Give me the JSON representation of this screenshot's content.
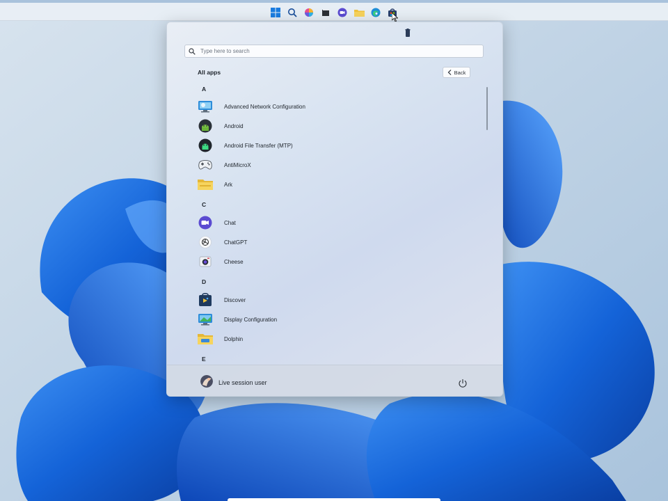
{
  "taskbar": {
    "icons": [
      "windows-start-icon",
      "search-icon",
      "copilot-icon",
      "task-view-icon",
      "chat-icon",
      "file-explorer-icon",
      "edge-icon",
      "store-icon"
    ]
  },
  "start_menu": {
    "search": {
      "placeholder": "Type here to search",
      "value": ""
    },
    "title": "All apps",
    "back_label": "Back",
    "sections": [
      {
        "letter": "A",
        "apps": [
          {
            "label": "Advanced Network Configuration",
            "icon": "network-config-icon"
          },
          {
            "label": "Android",
            "icon": "android-icon"
          },
          {
            "label": "Android File Transfer (MTP)",
            "icon": "android-file-transfer-icon"
          },
          {
            "label": "AntiMicroX",
            "icon": "gamepad-icon"
          },
          {
            "label": "Ark",
            "icon": "folder-icon"
          }
        ]
      },
      {
        "letter": "C",
        "apps": [
          {
            "label": "Chat",
            "icon": "chat-icon"
          },
          {
            "label": "ChatGPT",
            "icon": "chatgpt-icon"
          },
          {
            "label": "Cheese",
            "icon": "camera-icon"
          }
        ]
      },
      {
        "letter": "D",
        "apps": [
          {
            "label": "Discover",
            "icon": "discover-icon"
          },
          {
            "label": "Display Configuration",
            "icon": "display-config-icon"
          },
          {
            "label": "Dolphin",
            "icon": "folder-icon"
          }
        ]
      },
      {
        "letter": "E",
        "apps": []
      }
    ],
    "user": {
      "name": "Live session user"
    }
  },
  "colors": {
    "accent": "#1a66d6",
    "wallpaper_bg": "#bcd0e3"
  }
}
